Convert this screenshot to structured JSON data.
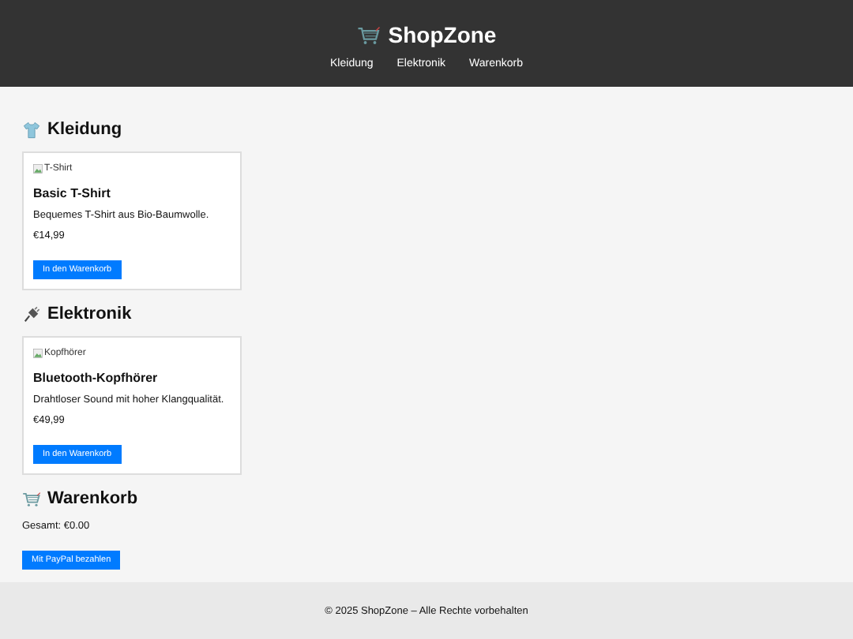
{
  "header": {
    "title": "ShopZone",
    "nav": [
      "Kleidung",
      "Elektronik",
      "Warenkorb"
    ]
  },
  "sections": [
    {
      "kind": "shirt",
      "heading": "Kleidung",
      "products": [
        {
          "image_alt": "T-Shirt",
          "name": "Basic T-Shirt",
          "description": "Bequemes T-Shirt aus Bio-Baumwolle.",
          "price": "€14,99",
          "button": "In den Warenkorb"
        }
      ]
    },
    {
      "kind": "plug",
      "heading": "Elektronik",
      "products": [
        {
          "image_alt": "Kopfhörer",
          "name": "Bluetooth-Kopfhörer",
          "description": "Drahtloser Sound mit hoher Klangqualität.",
          "price": "€49,99",
          "button": "In den Warenkorb"
        }
      ]
    }
  ],
  "cart": {
    "heading": "Warenkorb",
    "total": "Gesamt: €0.00",
    "button": "Mit PayPal bezahlen"
  },
  "footer": "© 2025 ShopZone – Alle Rechte vorbehalten"
}
